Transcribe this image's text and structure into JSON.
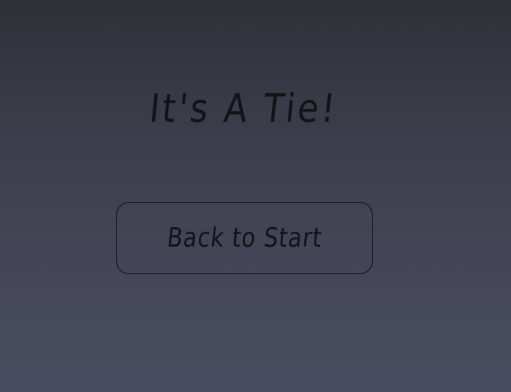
{
  "end_screen": {
    "result_text": "It's A Tie!",
    "back_button_label": "Back to Start"
  },
  "colors": {
    "background_top": "#2f3037",
    "background_bottom": "#4a4c61",
    "text": "#121317",
    "button_border": "#101116"
  }
}
